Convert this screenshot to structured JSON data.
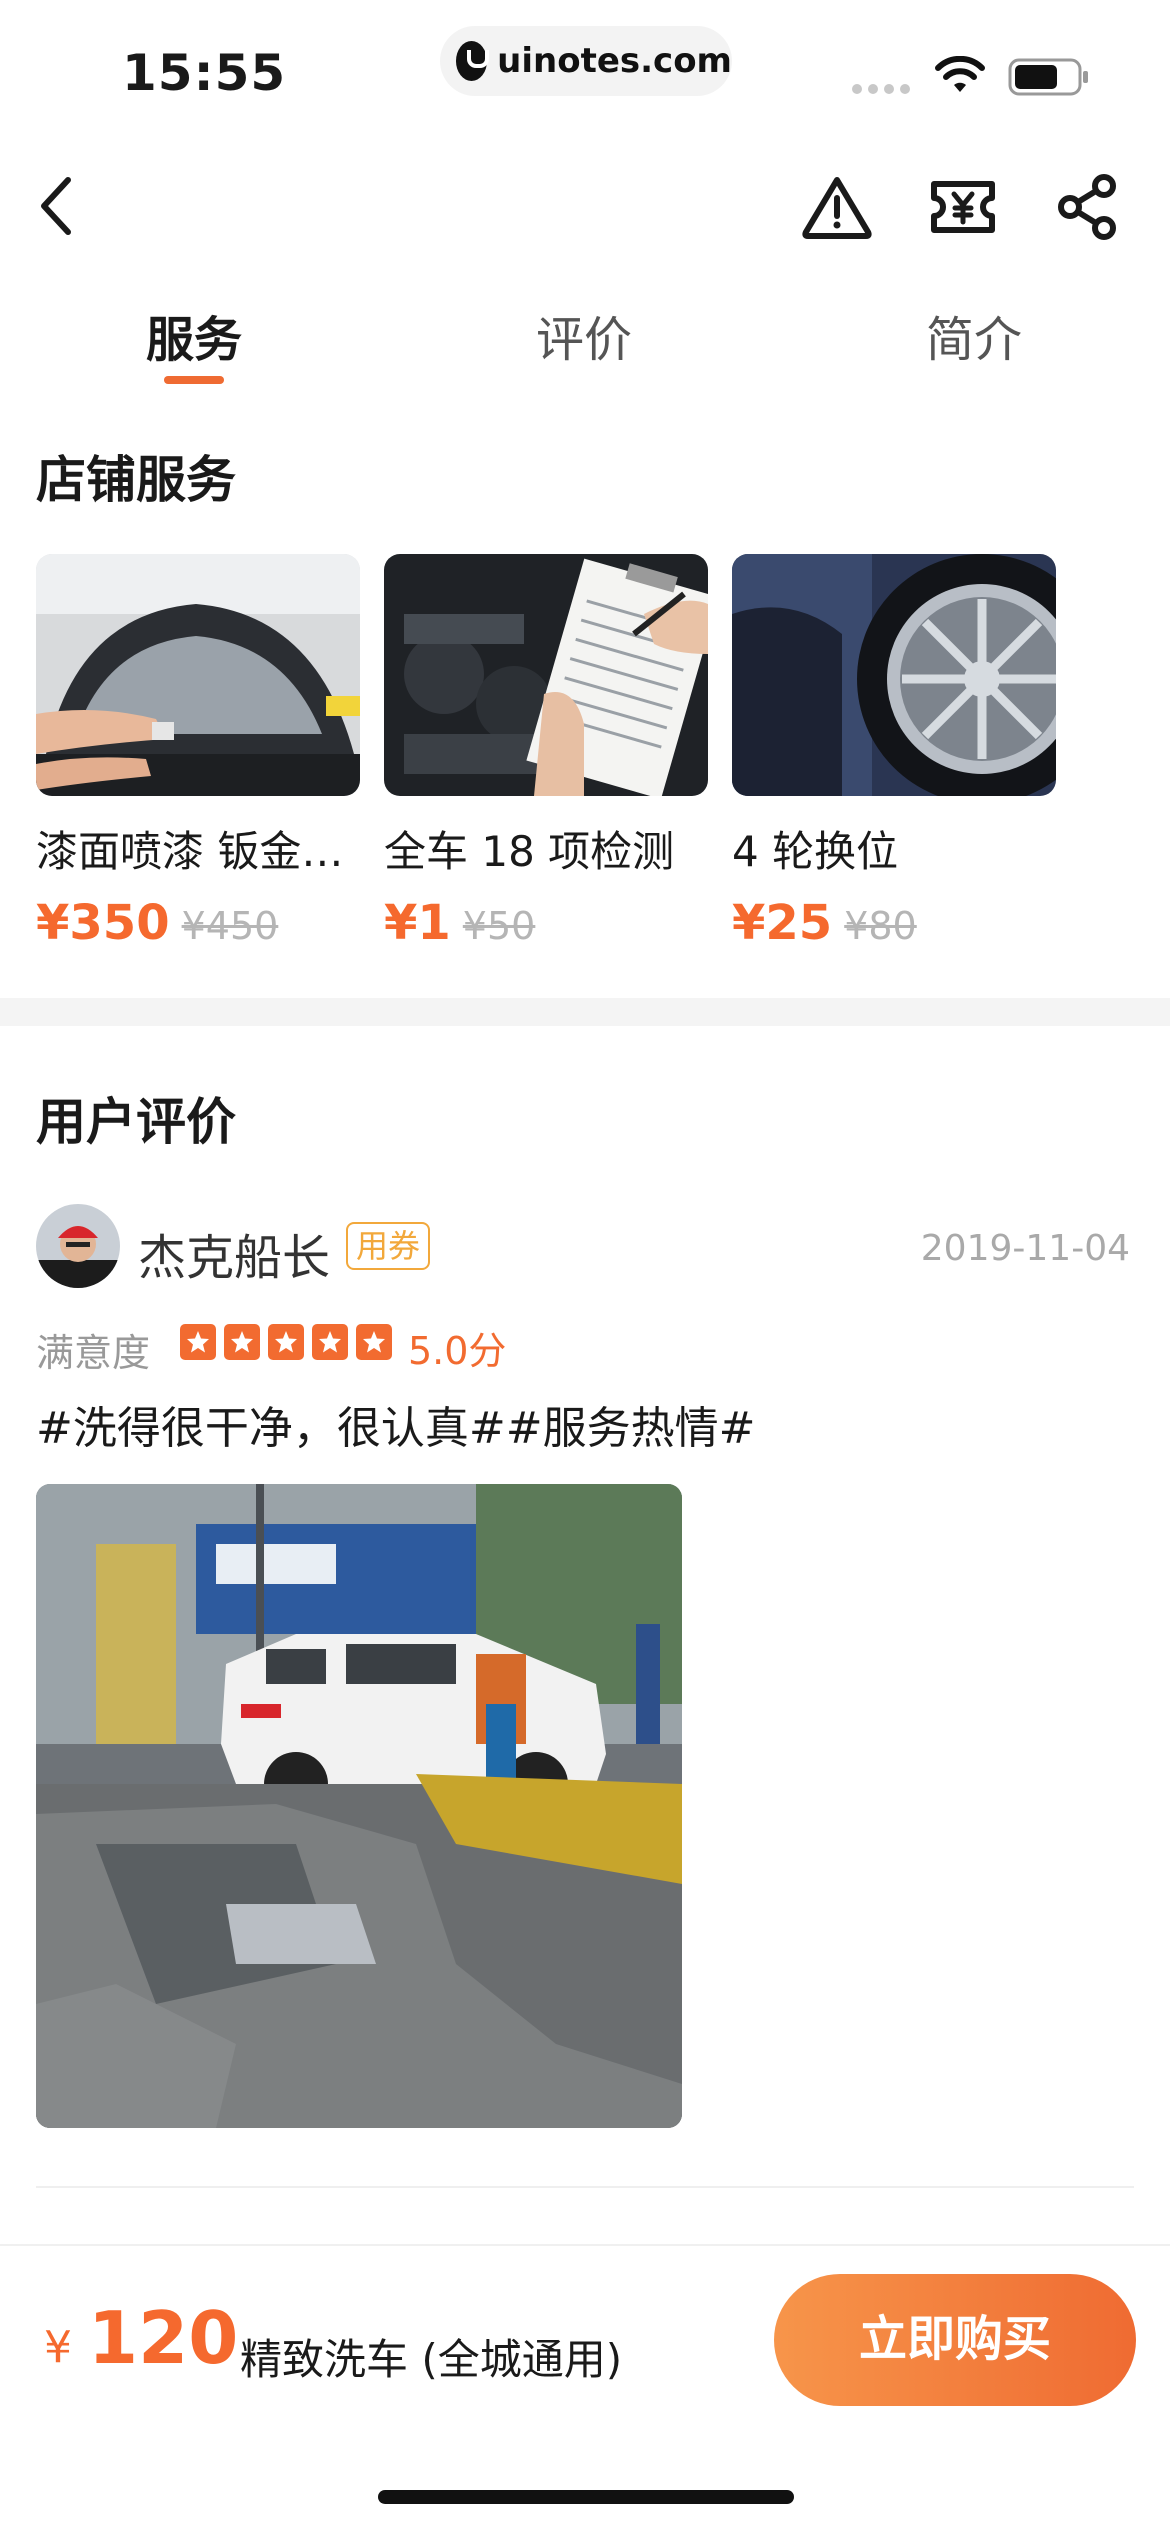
{
  "status_bar": {
    "time": "15:55",
    "url": "uinotes.com"
  },
  "nav": {
    "icons": [
      "back-icon",
      "warning-icon",
      "coupon-yuan-icon",
      "share-icon"
    ]
  },
  "tabs": [
    {
      "label": "服务",
      "active": true
    },
    {
      "label": "评价",
      "active": false
    },
    {
      "label": "简介",
      "active": false
    }
  ],
  "services": {
    "title": "店铺服务",
    "items": [
      {
        "name": "漆面喷漆 钣金…",
        "price": "¥350",
        "original_price": "¥450"
      },
      {
        "name": "全车 18 项检测",
        "price": "¥1",
        "original_price": "¥50"
      },
      {
        "name": "4 轮换位",
        "price": "¥25",
        "original_price": "¥80"
      }
    ]
  },
  "reviews": {
    "title": "用户评价",
    "items": [
      {
        "user_name": "杰克船长",
        "tag": "用券",
        "date": "2019-11-04",
        "satisfaction_label": "满意度",
        "rating": 5,
        "score_text": "5.0分",
        "text": "#洗得很干净，很认真##服务热情#"
      }
    ]
  },
  "bottom_bar": {
    "currency": "¥",
    "price": "120",
    "product_name": "精致洗车 (全城通用)",
    "buy_label": "立即购买"
  },
  "colors": {
    "accent": "#f5692e",
    "coupon": "#f2a83b",
    "muted": "#b5b5b5"
  }
}
